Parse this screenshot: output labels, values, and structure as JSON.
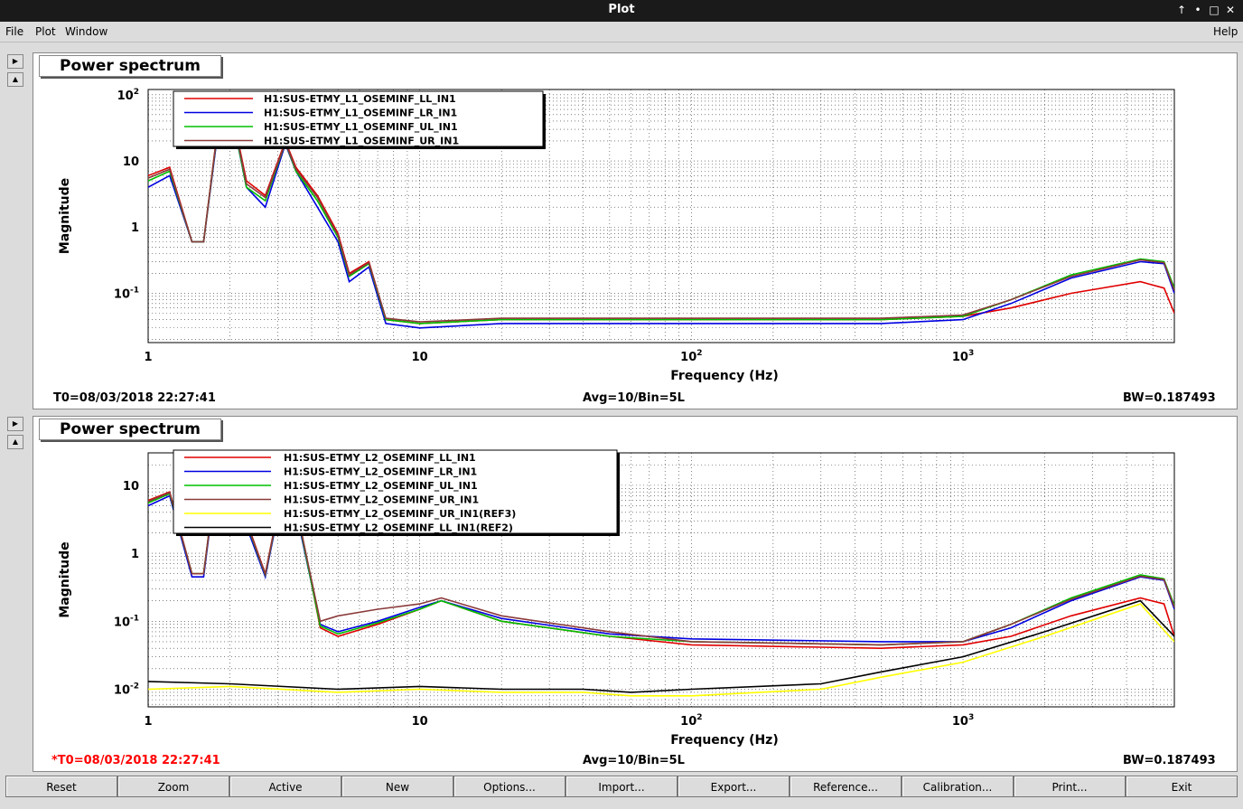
{
  "window": {
    "title": "Plot",
    "controls": [
      "↑",
      "•",
      "□",
      "✕"
    ]
  },
  "menu": {
    "file": "File",
    "plot": "Plot",
    "window": "Window",
    "help": "Help"
  },
  "panel1": {
    "title": "Power spectrum",
    "t0": "T0=08/03/2018 22:27:41",
    "avg": "Avg=10/Bin=5L",
    "bw": "BW=0.187493"
  },
  "panel2": {
    "title": "Power spectrum",
    "t0": "*T0=08/03/2018 22:27:41",
    "avg": "Avg=10/Bin=5L",
    "bw": "BW=0.187493"
  },
  "buttons": [
    "Reset",
    "Zoom",
    "Active",
    "New",
    "Options...",
    "Import...",
    "Export...",
    "Reference...",
    "Calibration...",
    "Print...",
    "Exit"
  ],
  "colors": {
    "red": "#e00000",
    "blue": "#0000e0",
    "green": "#00c000",
    "brown": "#8b3a3a",
    "yellow": "#ffff00",
    "black": "#000000",
    "t0_alert": "#ff0000"
  },
  "chart_data": [
    {
      "type": "line",
      "title": "",
      "xlabel": "Frequency (Hz)",
      "ylabel": "Magnitude",
      "xscale": "log",
      "yscale": "log",
      "xlim": [
        1,
        6000
      ],
      "ylim": [
        0.018,
        120
      ],
      "x_ticks": [
        "1",
        "10",
        "10^2",
        "10^3"
      ],
      "y_ticks": [
        "10^-1",
        "1",
        "10",
        "10^2"
      ],
      "grid": true,
      "legend": "top-left",
      "series": [
        {
          "name": "H1:SUS-ETMY_L1_OSEMINF_LL_IN1",
          "color": "#e00000",
          "x": [
            1,
            1.2,
            1.45,
            1.6,
            1.8,
            2,
            2.3,
            2.7,
            3.2,
            3.5,
            4.2,
            5,
            5.5,
            6.5,
            7.5,
            10,
            20,
            50,
            100,
            500,
            1000,
            1500,
            2500,
            4500,
            5500,
            6000
          ],
          "y": [
            6,
            8,
            0.6,
            0.6,
            30,
            80,
            5,
            3,
            20,
            8,
            3,
            0.8,
            0.2,
            0.3,
            0.04,
            0.035,
            0.04,
            0.04,
            0.04,
            0.04,
            0.045,
            0.06,
            0.1,
            0.15,
            0.12,
            0.05
          ]
        },
        {
          "name": "H1:SUS-ETMY_L1_OSEMINF_LR_IN1",
          "color": "#0000e0",
          "x": [
            1,
            1.2,
            1.45,
            1.6,
            1.8,
            2,
            2.3,
            2.7,
            3.2,
            3.5,
            4.2,
            5,
            5.5,
            6.5,
            7.5,
            10,
            20,
            50,
            100,
            500,
            1000,
            1500,
            2500,
            4500,
            5500,
            6000
          ],
          "y": [
            4,
            6,
            0.6,
            0.6,
            25,
            70,
            4,
            2,
            18,
            7,
            2,
            0.6,
            0.15,
            0.25,
            0.035,
            0.03,
            0.035,
            0.035,
            0.035,
            0.035,
            0.04,
            0.07,
            0.17,
            0.3,
            0.28,
            0.1
          ]
        },
        {
          "name": "H1:SUS-ETMY_L1_OSEMINF_UL_IN1",
          "color": "#00c000",
          "x": [
            1,
            1.2,
            1.45,
            1.6,
            1.8,
            2,
            2.3,
            2.7,
            3.2,
            3.5,
            4.2,
            5,
            5.5,
            6.5,
            7.5,
            10,
            20,
            50,
            100,
            500,
            1000,
            1500,
            2500,
            4500,
            5500,
            6000
          ],
          "y": [
            5,
            7,
            0.6,
            0.6,
            28,
            75,
            4,
            2.5,
            19,
            7,
            2.5,
            0.7,
            0.18,
            0.28,
            0.04,
            0.035,
            0.04,
            0.04,
            0.04,
            0.04,
            0.045,
            0.08,
            0.19,
            0.33,
            0.3,
            0.12
          ]
        },
        {
          "name": "H1:SUS-ETMY_L1_OSEMINF_UR_IN1",
          "color": "#8b3a3a",
          "x": [
            1,
            1.2,
            1.45,
            1.6,
            1.8,
            2,
            2.3,
            2.7,
            3.2,
            3.5,
            4.2,
            5,
            5.5,
            6.5,
            7.5,
            10,
            20,
            50,
            100,
            500,
            1000,
            1500,
            2500,
            4500,
            5500,
            6000
          ],
          "y": [
            5.5,
            7.5,
            0.6,
            0.6,
            29,
            78,
            4.5,
            2.8,
            19,
            7.5,
            2.8,
            0.75,
            0.19,
            0.29,
            0.042,
            0.037,
            0.042,
            0.042,
            0.042,
            0.042,
            0.047,
            0.08,
            0.18,
            0.32,
            0.29,
            0.11
          ]
        }
      ]
    },
    {
      "type": "line",
      "title": "",
      "xlabel": "Frequency (Hz)",
      "ylabel": "Magnitude",
      "xscale": "log",
      "yscale": "log",
      "xlim": [
        1,
        6000
      ],
      "ylim": [
        0.0055,
        30
      ],
      "x_ticks": [
        "1",
        "10",
        "10^2",
        "10^3"
      ],
      "y_ticks": [
        "10^-2",
        "10^-1",
        "1",
        "10"
      ],
      "grid": true,
      "legend": "top-left",
      "series": [
        {
          "name": "H1:SUS-ETMY_L2_OSEMINF_LL_IN1",
          "color": "#e00000",
          "x": [
            1,
            1.2,
            1.45,
            1.6,
            1.8,
            2,
            2.3,
            2.7,
            3.2,
            3.6,
            4.3,
            5,
            7,
            10,
            12,
            20,
            50,
            100,
            500,
            1000,
            1500,
            2500,
            4500,
            5500,
            6000
          ],
          "y": [
            6,
            8,
            0.5,
            0.5,
            20,
            50,
            3,
            0.5,
            15,
            3,
            0.08,
            0.06,
            0.09,
            0.15,
            0.2,
            0.1,
            0.06,
            0.045,
            0.04,
            0.045,
            0.06,
            0.12,
            0.22,
            0.18,
            0.06
          ]
        },
        {
          "name": "H1:SUS-ETMY_L2_OSEMINF_LR_IN1",
          "color": "#0000e0",
          "x": [
            1,
            1.2,
            1.45,
            1.6,
            1.8,
            2,
            2.3,
            2.7,
            3.2,
            3.6,
            4.3,
            5,
            7,
            10,
            12,
            20,
            50,
            100,
            500,
            1000,
            1500,
            2500,
            4500,
            5500,
            6000
          ],
          "y": [
            5,
            7,
            0.45,
            0.45,
            18,
            45,
            2.5,
            0.45,
            13,
            2.5,
            0.09,
            0.07,
            0.1,
            0.16,
            0.2,
            0.11,
            0.065,
            0.055,
            0.05,
            0.05,
            0.08,
            0.2,
            0.45,
            0.4,
            0.15
          ]
        },
        {
          "name": "H1:SUS-ETMY_L2_OSEMINF_UL_IN1",
          "color": "#00c000",
          "x": [
            1,
            1.2,
            1.45,
            1.6,
            1.8,
            2,
            2.3,
            2.7,
            3.2,
            3.6,
            4.3,
            5,
            7,
            10,
            12,
            20,
            50,
            100,
            500,
            1000,
            1500,
            2500,
            4500,
            5500,
            6000
          ],
          "y": [
            5.5,
            7.5,
            0.5,
            0.5,
            19,
            48,
            2.8,
            0.48,
            14,
            2.8,
            0.085,
            0.065,
            0.095,
            0.15,
            0.2,
            0.1,
            0.06,
            0.05,
            0.045,
            0.05,
            0.09,
            0.22,
            0.48,
            0.42,
            0.17
          ]
        },
        {
          "name": "H1:SUS-ETMY_L2_OSEMINF_UR_IN1",
          "color": "#8b3a3a",
          "x": [
            1,
            1.2,
            1.45,
            1.6,
            1.8,
            2,
            2.3,
            2.7,
            3.2,
            3.6,
            4.3,
            5,
            7,
            10,
            12,
            20,
            50,
            100,
            500,
            1000,
            1500,
            2500,
            4500,
            5500,
            6000
          ],
          "y": [
            5.8,
            7.8,
            0.5,
            0.5,
            19,
            49,
            2.9,
            0.49,
            14.5,
            2.9,
            0.1,
            0.12,
            0.15,
            0.18,
            0.22,
            0.12,
            0.07,
            0.05,
            0.045,
            0.05,
            0.09,
            0.21,
            0.46,
            0.41,
            0.16
          ]
        },
        {
          "name": "H1:SUS-ETMY_L2_OSEMINF_UR_IN1(REF3)",
          "color": "#ffff00",
          "x": [
            1,
            2,
            5,
            10,
            20,
            40,
            60,
            100,
            300,
            500,
            1000,
            2000,
            4500,
            6000
          ],
          "y": [
            0.01,
            0.011,
            0.009,
            0.01,
            0.009,
            0.009,
            0.008,
            0.008,
            0.01,
            0.015,
            0.025,
            0.06,
            0.18,
            0.05
          ]
        },
        {
          "name": "H1:SUS-ETMY_L2_OSEMINF_LL_IN1(REF2)",
          "color": "#000000",
          "x": [
            1,
            2,
            5,
            10,
            20,
            40,
            60,
            100,
            300,
            500,
            1000,
            2000,
            4500,
            6000
          ],
          "y": [
            0.013,
            0.012,
            0.01,
            0.011,
            0.01,
            0.01,
            0.009,
            0.01,
            0.012,
            0.018,
            0.03,
            0.07,
            0.2,
            0.06
          ]
        }
      ]
    }
  ]
}
